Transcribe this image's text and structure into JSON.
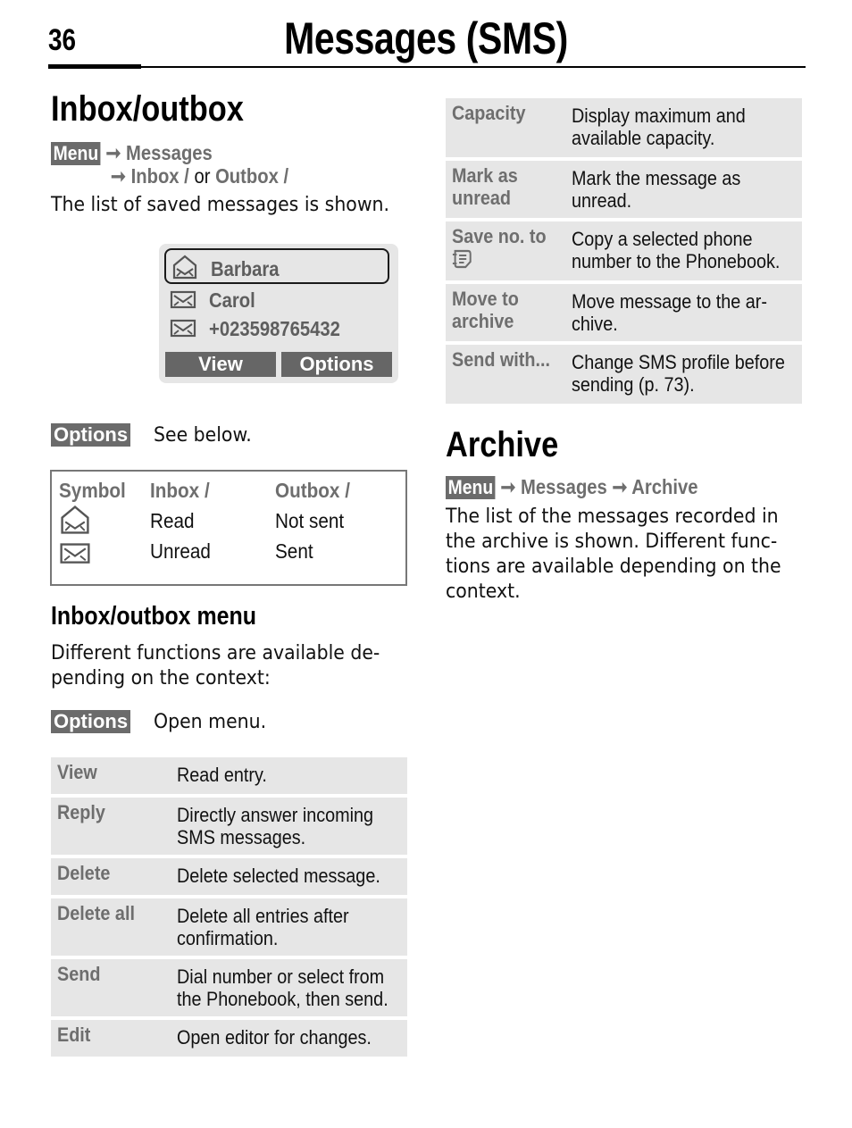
{
  "header": {
    "page_number": "36",
    "chapter_title": "Messages (SMS)"
  },
  "inbox_outbox": {
    "title": "Inbox/outbox",
    "path": {
      "menu_key": "Menu",
      "arrow": "➞",
      "step1": "Messages",
      "step2a": "Inbox /",
      "or": " or ",
      "step2b": "Outbox /"
    },
    "description": "The list of saved messages is shown.",
    "phone_display": {
      "rows": [
        {
          "icon": "envelope-open-icon",
          "label": "Barbara",
          "selected": true
        },
        {
          "icon": "envelope-closed-icon",
          "label": "Carol",
          "selected": false
        },
        {
          "icon": "envelope-closed-icon",
          "label": "+023598765432",
          "selected": false
        }
      ],
      "left_softkey": "View",
      "right_softkey": "Options"
    },
    "options_key": "Options",
    "options_text": "See below.",
    "symbol_table": {
      "headers": [
        "Symbol",
        "Inbox /",
        "Outbox /"
      ],
      "rows": [
        {
          "symbol": "envelope-open-icon",
          "inbox": "Read",
          "outbox": "Not sent"
        },
        {
          "symbol": "envelope-closed-icon",
          "inbox": "Unread",
          "outbox": "Sent"
        }
      ]
    }
  },
  "inbox_outbox_menu": {
    "title": "Inbox/outbox menu",
    "description_line1": "Different functions are available de-",
    "description_line2": "pending on the context:",
    "options_key": "Options",
    "options_text": "Open menu.",
    "items": [
      {
        "term": "View",
        "desc": [
          "Read entry."
        ]
      },
      {
        "term": "Reply",
        "desc": [
          "Directly answer incoming",
          "SMS messages."
        ]
      },
      {
        "term": "Delete",
        "desc": [
          "Delete selected message."
        ]
      },
      {
        "term": "Delete all",
        "desc": [
          "Delete all entries after",
          "confirmation."
        ]
      },
      {
        "term": "Send",
        "desc": [
          "Dial number or select from",
          "the Phonebook, then send."
        ]
      },
      {
        "term": "Edit",
        "desc": [
          "Open editor for changes."
        ]
      }
    ]
  },
  "menu_continued": {
    "items": [
      {
        "term": [
          "Capacity"
        ],
        "desc": [
          "Display maximum and",
          "available capacity."
        ]
      },
      {
        "term": [
          "Mark as",
          "unread"
        ],
        "desc": [
          "Mark the message as",
          "unread."
        ]
      },
      {
        "term": [
          "Save no. to"
        ],
        "term_icon": "phonebook-icon",
        "desc": [
          "Copy a selected phone",
          "number to the Phonebook."
        ]
      },
      {
        "term": [
          "Move to",
          "archive"
        ],
        "desc": [
          "Move message to the ar-",
          "chive."
        ]
      },
      {
        "term": [
          "Send with..."
        ],
        "desc": [
          "Change SMS profile before",
          "sending (p. 73)."
        ]
      }
    ]
  },
  "archive": {
    "title": "Archive",
    "path": {
      "menu_key": "Menu",
      "arrow": "➞",
      "step1": "Messages",
      "step2": "Archive"
    },
    "description": [
      "The list of the messages recorded in",
      "the archive is shown. Different func-",
      "tions are available depending on the",
      "context."
    ]
  }
}
